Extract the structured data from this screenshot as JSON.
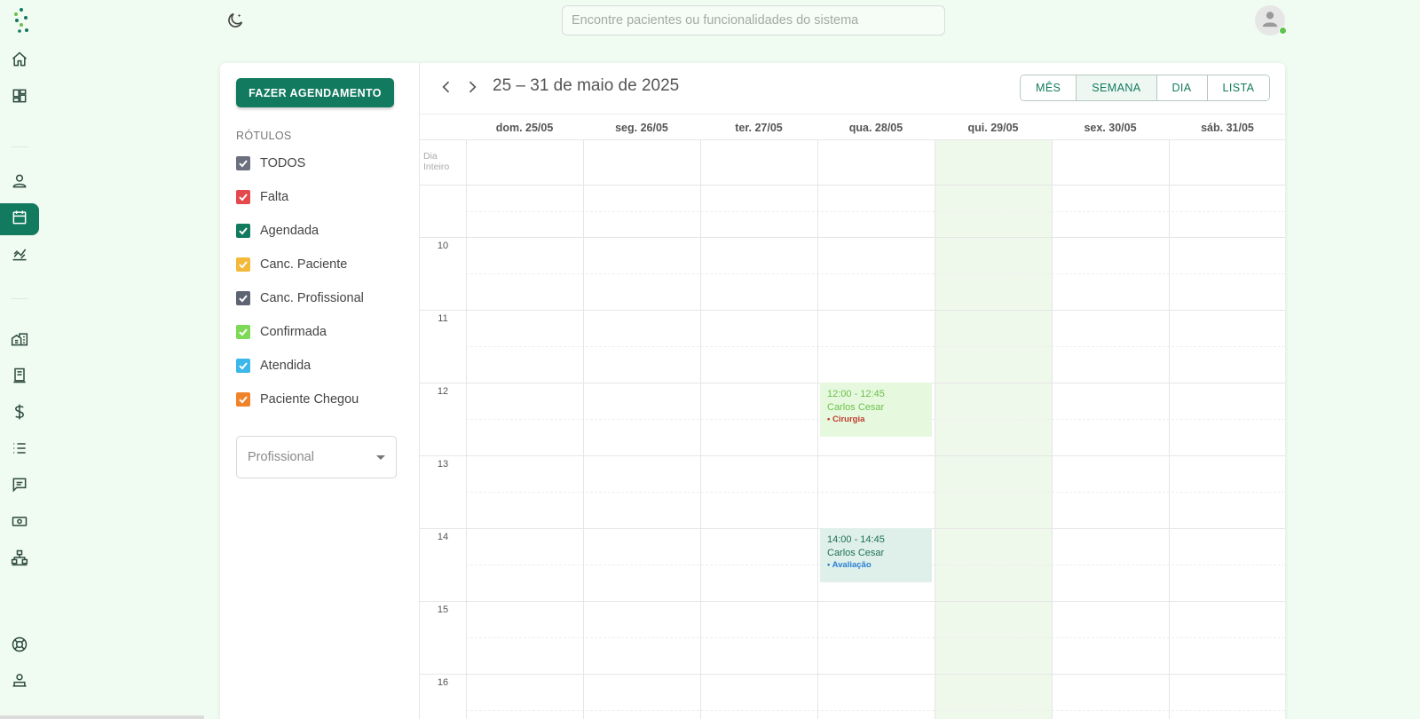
{
  "topbar": {
    "search_placeholder": "Encontre pacientes ou funcionalidades do sistema"
  },
  "sidebar": {
    "items": [
      {
        "name": "home-icon"
      },
      {
        "name": "dashboard-icon"
      },
      {
        "name": "user-icon"
      },
      {
        "name": "calendar-icon",
        "active": true
      },
      {
        "name": "chart-icon"
      },
      {
        "name": "buildings-icon"
      },
      {
        "name": "document-icon"
      },
      {
        "name": "dollar-icon"
      },
      {
        "name": "list-icon"
      },
      {
        "name": "message-icon"
      },
      {
        "name": "money-icon"
      },
      {
        "name": "hierarchy-icon"
      },
      {
        "name": "support-icon"
      },
      {
        "name": "user-settings-icon"
      }
    ]
  },
  "left_panel": {
    "new_appointment": "FAZER AGENDAMENTO",
    "labels_title": "RÓTULOS",
    "labels": [
      {
        "label": "TODOS",
        "color": "#6b6f7e"
      },
      {
        "label": "Falta",
        "color": "#e5484d"
      },
      {
        "label": "Agendada",
        "color": "#127a5e"
      },
      {
        "label": "Canc. Paciente",
        "color": "#f3b93a"
      },
      {
        "label": "Canc. Profissional",
        "color": "#5f6473"
      },
      {
        "label": "Confirmada",
        "color": "#7ed957"
      },
      {
        "label": "Atendida",
        "color": "#3bb7ea"
      },
      {
        "label": "Paciente Chegou",
        "color": "#f0832a"
      }
    ],
    "professional_placeholder": "Profissional"
  },
  "calendar": {
    "title": "25 – 31 de maio de 2025",
    "views": [
      "MÊS",
      "SEMANA",
      "DIA",
      "LISTA"
    ],
    "active_view": "SEMANA",
    "days": [
      "dom. 25/05",
      "seg. 26/05",
      "ter. 27/05",
      "qua. 28/05",
      "qui. 29/05",
      "sex. 30/05",
      "sáb. 31/05"
    ],
    "today_index": 4,
    "all_day_label": [
      "Dia",
      "Inteiro"
    ],
    "hours": [
      "10",
      "11",
      "12",
      "13",
      "14",
      "15",
      "16"
    ],
    "events": [
      {
        "day_index": 3,
        "time": "12:00 - 12:45",
        "patient": "Carlos Cesar",
        "tag": "• Cirurgia",
        "bg": "#e6f9df",
        "text_color": "#6cc04a",
        "tag_color": "#c0392b"
      },
      {
        "day_index": 3,
        "time": "14:00 - 14:45",
        "patient": "Carlos Cesar",
        "tag": "• Avaliação",
        "bg": "#dff0ea",
        "text_color": "#1e6f57",
        "tag_color": "#2a7fd4"
      }
    ]
  },
  "colors": {
    "accent": "#127a5e",
    "background": "#f0fbf1",
    "today_column": "#eef9ec"
  }
}
